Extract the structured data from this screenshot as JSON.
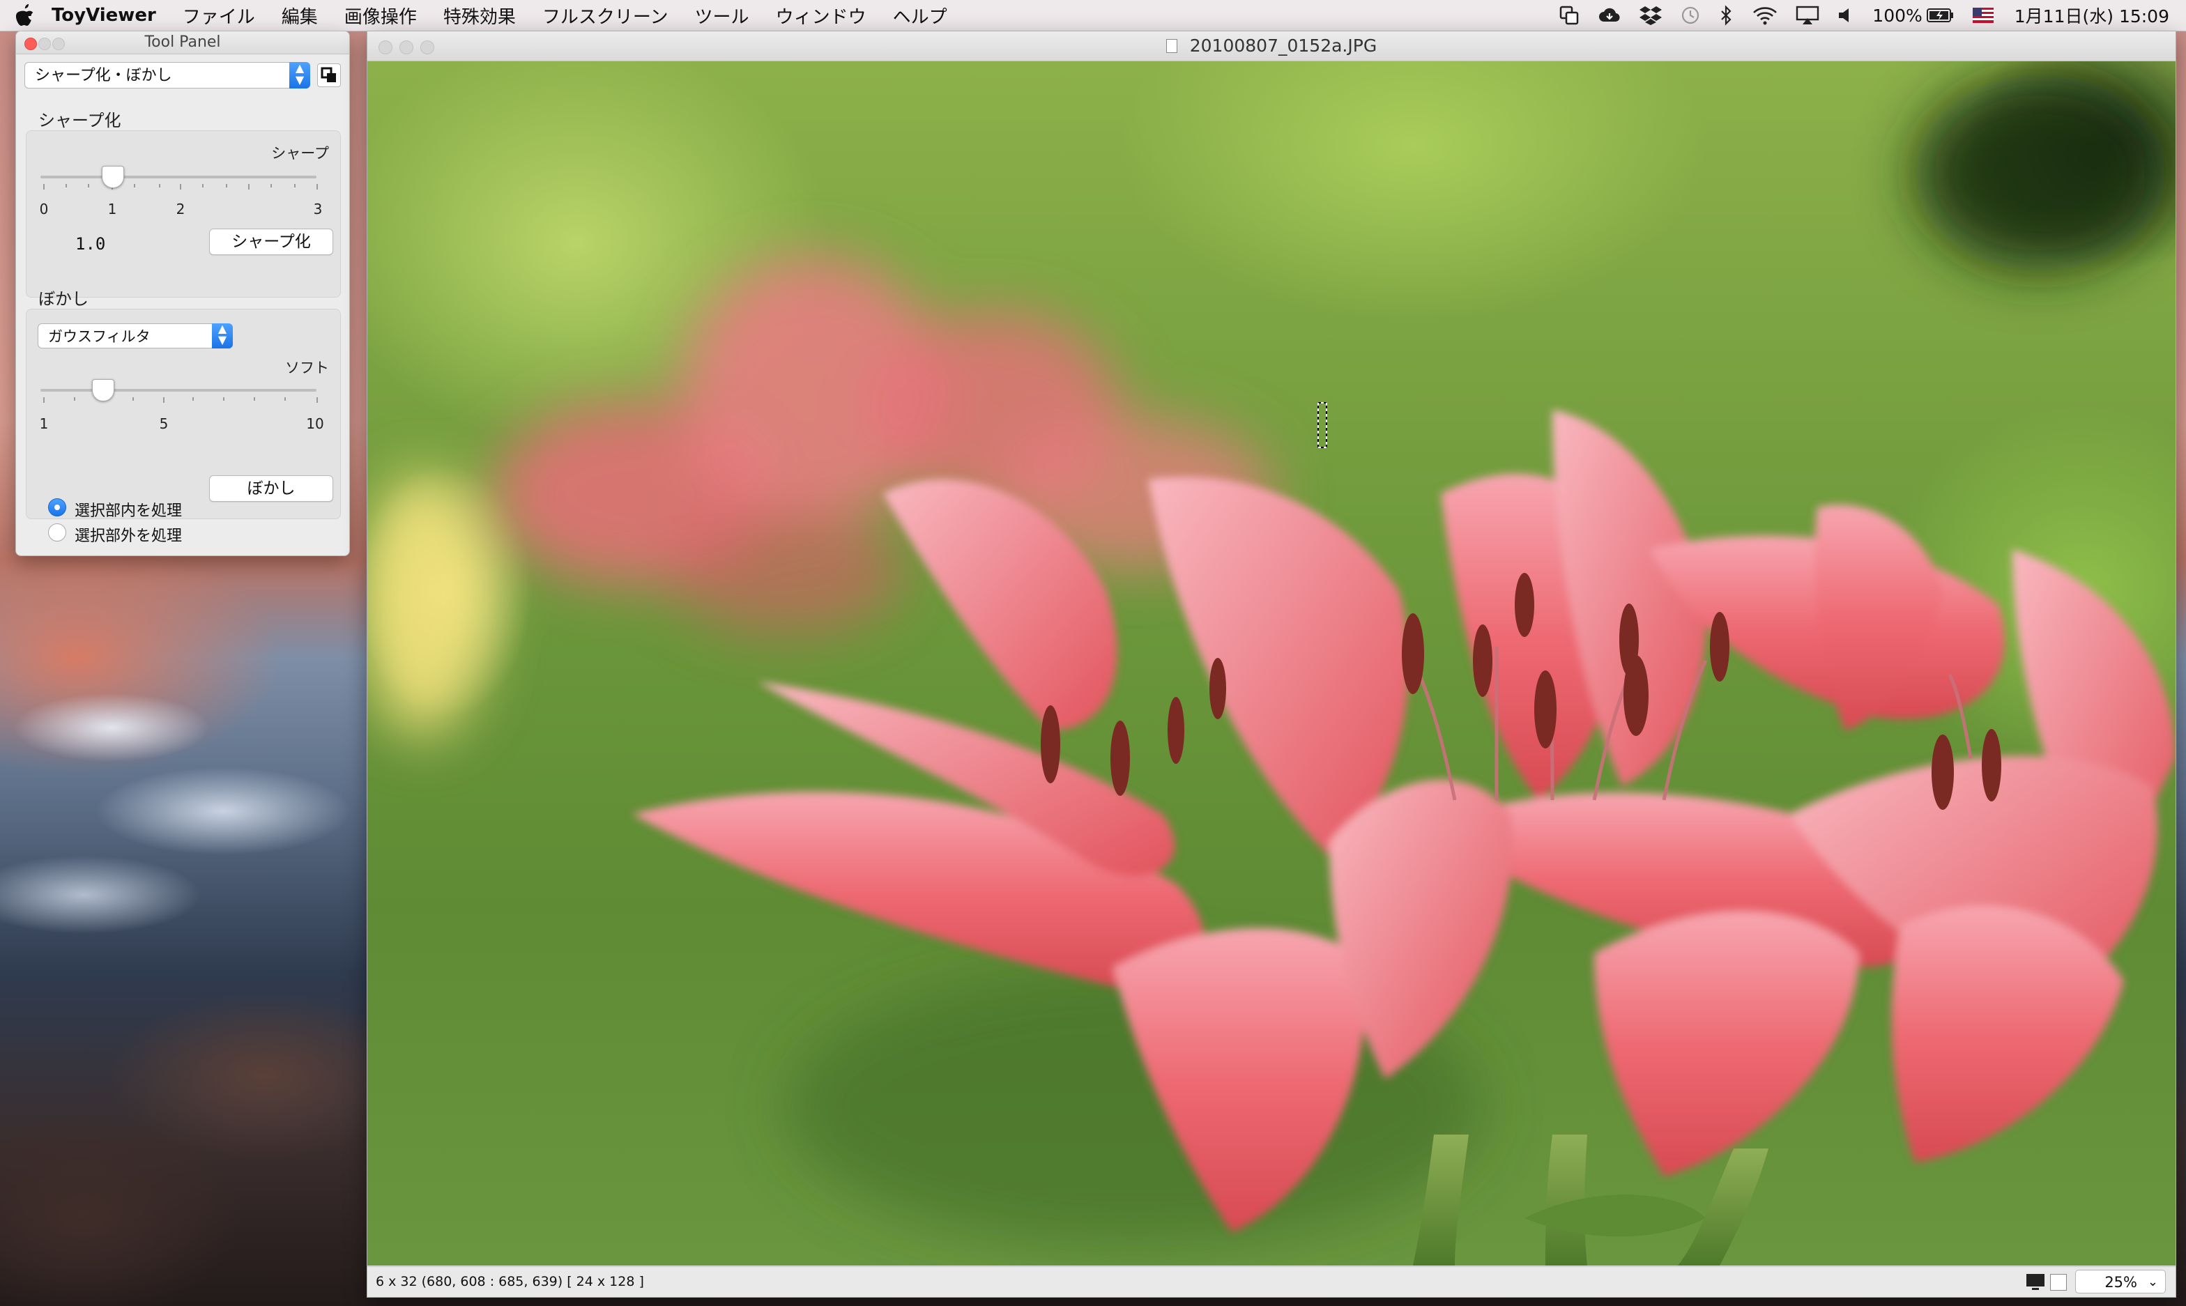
{
  "menubar": {
    "app_name": "ToyViewer",
    "items": [
      "ファイル",
      "編集",
      "画像操作",
      "特殊効果",
      "フルスクリーン",
      "ツール",
      "ウィンドウ",
      "ヘルプ"
    ],
    "status": {
      "battery": "100%",
      "datetime": "1月11日(水)  15:09",
      "icons": [
        "screen-sharing-icon",
        "creative-cloud-icon",
        "dropbox-icon",
        "time-machine-icon",
        "bluetooth-icon",
        "wifi-icon",
        "airplay-icon",
        "volume-icon",
        "battery-icon",
        "us-flag-icon"
      ]
    }
  },
  "tool_panel": {
    "title": "Tool Panel",
    "mode_select": "シャープ化・ぼかし",
    "sharpen": {
      "section_label": "シャープ化",
      "slider_caption": "シャープ",
      "ticks": [
        "0",
        "1",
        "2",
        "3"
      ],
      "value_display": "1.0",
      "value": 1.0,
      "range": [
        0,
        3
      ],
      "button": "シャープ化"
    },
    "blur": {
      "section_label": "ぼかし",
      "filter_select": "ガウスフィルタ",
      "slider_caption": "ソフト",
      "ticks": [
        "1",
        "5",
        "10"
      ],
      "value": 3,
      "range": [
        1,
        10
      ],
      "button": "ぼかし"
    },
    "radios": [
      {
        "label": "選択部内を処理",
        "checked": true
      },
      {
        "label": "選択部外を処理",
        "checked": false
      }
    ]
  },
  "image_window": {
    "title": "20100807_0152a.JPG",
    "status_text": "6 x 32  (680, 608 : 685, 639)  [ 24 x 128 ]",
    "zoom": "25%"
  },
  "colors": {
    "accent": "#1a73e8",
    "close_red": "#fc5f57",
    "minimize_yellow": "#d6d6d6"
  }
}
